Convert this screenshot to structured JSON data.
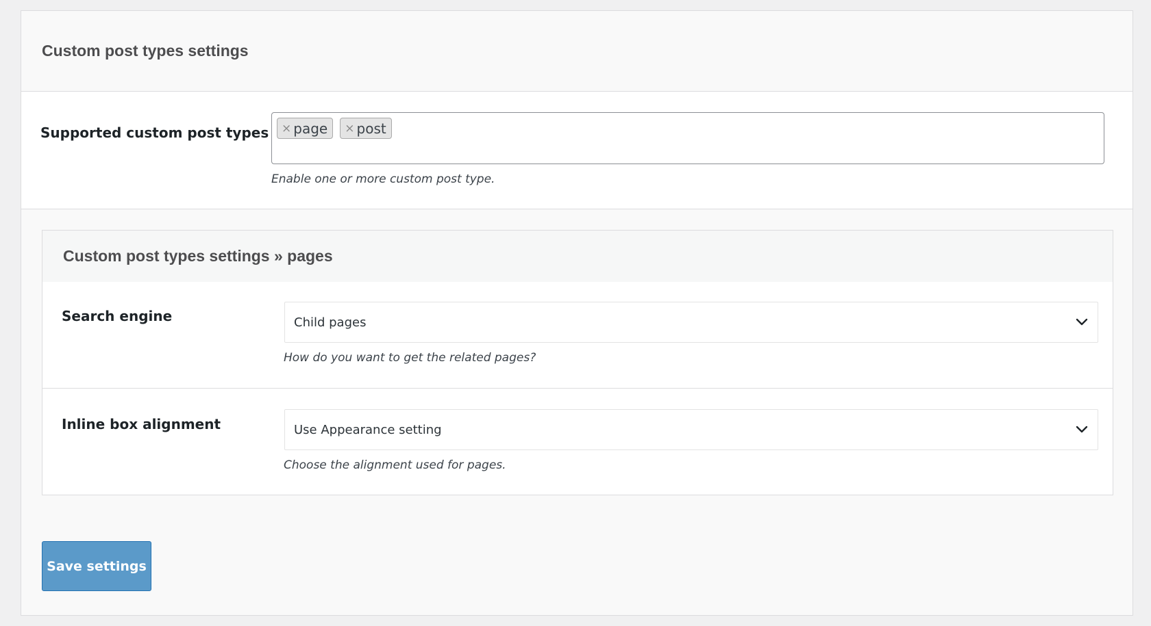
{
  "panel": {
    "title": "Custom post types settings"
  },
  "supported": {
    "label": "Supported custom post types",
    "tags": [
      {
        "label": "page",
        "remove": "×"
      },
      {
        "label": "post",
        "remove": "×"
      }
    ],
    "help": "Enable one or more custom post type."
  },
  "pages_section": {
    "title": "Custom post types settings » pages",
    "search_engine": {
      "label": "Search engine",
      "value": "Child pages",
      "help": "How do you want to get the related pages?"
    },
    "alignment": {
      "label": "Inline box alignment",
      "value": "Use Appearance setting",
      "help": "Choose the alignment used for pages."
    }
  },
  "footer": {
    "save_label": "Save settings"
  },
  "colors": {
    "button_bg": "#5b9ac9",
    "button_border": "#2271b1",
    "panel_bg": "#f9f9f9"
  }
}
